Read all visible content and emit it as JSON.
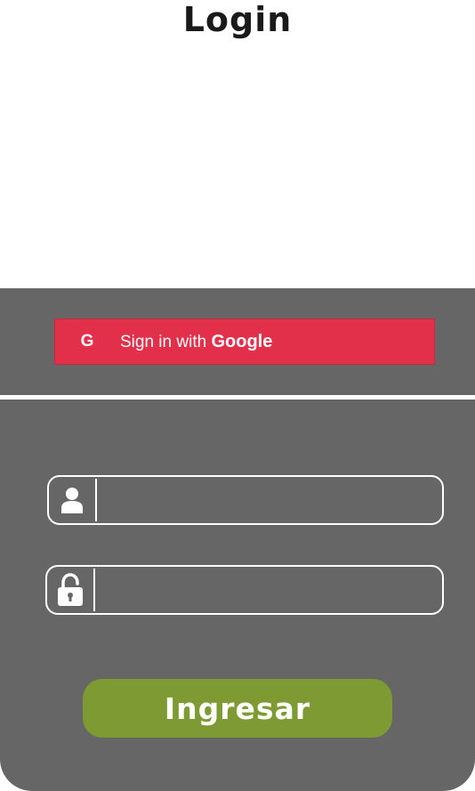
{
  "header": {
    "title": "Login"
  },
  "google": {
    "icon_letter": "G",
    "label_plain": "Sign in with ",
    "label_brand": "Google",
    "color": "#e2304a"
  },
  "form": {
    "username": {
      "icon": "user-icon",
      "value": "",
      "placeholder": ""
    },
    "password": {
      "icon": "lock-icon",
      "value": "",
      "placeholder": ""
    },
    "submit_label": "Ingresar",
    "submit_color": "#7e9a32"
  },
  "theme": {
    "panel_color": "#666666"
  }
}
